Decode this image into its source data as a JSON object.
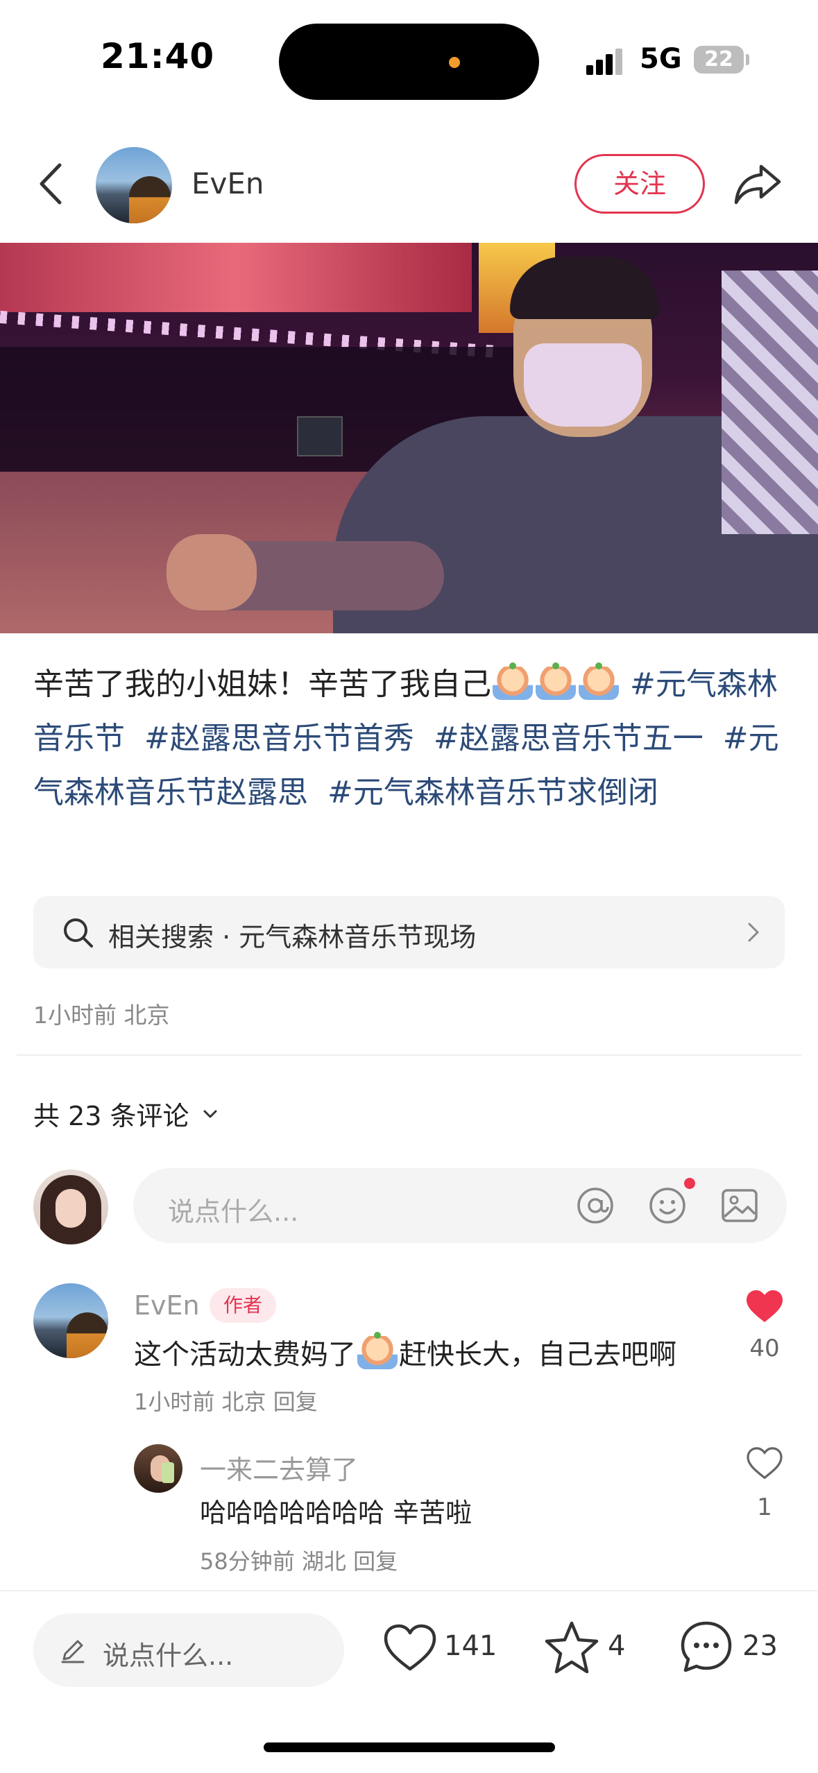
{
  "status": {
    "time": "21:40",
    "network": "5G",
    "battery": "22"
  },
  "header": {
    "username": "EvEn",
    "follow_label": "关注"
  },
  "post": {
    "caption_text": "辛苦了我的小姐妹！辛苦了我自己",
    "tags": [
      "#元气森林音乐节",
      "#赵露思音乐节首秀",
      "#赵露思音乐节五一",
      "#元气森林音乐节赵露思",
      "#元气森林音乐节求倒闭"
    ],
    "related_search": "相关搜索 · 元气森林音乐节现场",
    "time_location": "1小时前 北京"
  },
  "comments": {
    "count_label": "共 23 条评论",
    "input_placeholder": "说点什么...",
    "items": [
      {
        "name": "EvEn",
        "badge": "作者",
        "text_before": "这个活动太费妈了",
        "text_after": "赶快长大，自己去吧啊",
        "meta": "1小时前 北京 回复",
        "likes": "40",
        "liked": true
      }
    ],
    "reply": {
      "name": "一来二去算了",
      "text": "哈哈哈哈哈哈哈  辛苦啦",
      "meta": "58分钟前 湖北 回复",
      "likes": "1"
    }
  },
  "bottom_bar": {
    "placeholder": "说点什么...",
    "likes": "141",
    "stars": "4",
    "comments": "23"
  },
  "colors": {
    "accent": "#e33450",
    "tag": "#2b4a78"
  }
}
